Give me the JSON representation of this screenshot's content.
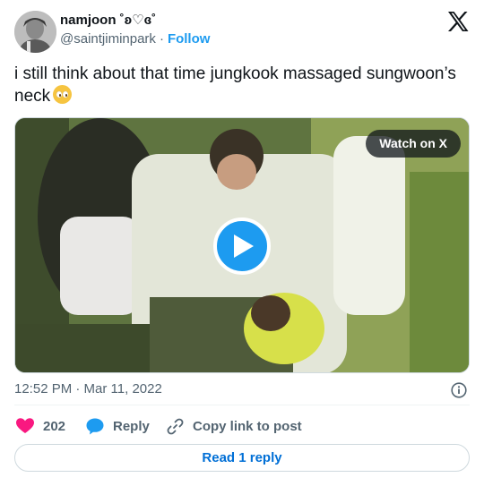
{
  "author": {
    "display_name": "namjoon ˚ʚ♡ɞ˚",
    "handle": "@saintjiminpark",
    "separator": "·",
    "follow_label": "Follow"
  },
  "tweet": {
    "text": "i still think about that time jungkook massaged sungwoon’s neck",
    "emoji_name": "pleading-face-icon"
  },
  "media": {
    "watch_label": "Watch on X"
  },
  "meta": {
    "timestamp": "12:52 PM · Mar 11, 2022"
  },
  "actions": {
    "like_count": "202",
    "reply_label": "Reply",
    "copy_label": "Copy link to post"
  },
  "footer": {
    "read_reply_label": "Read 1 reply"
  },
  "colors": {
    "accent": "#1d9bf0",
    "like": "#f91880",
    "link": "#006fd6",
    "muted": "#536471"
  }
}
